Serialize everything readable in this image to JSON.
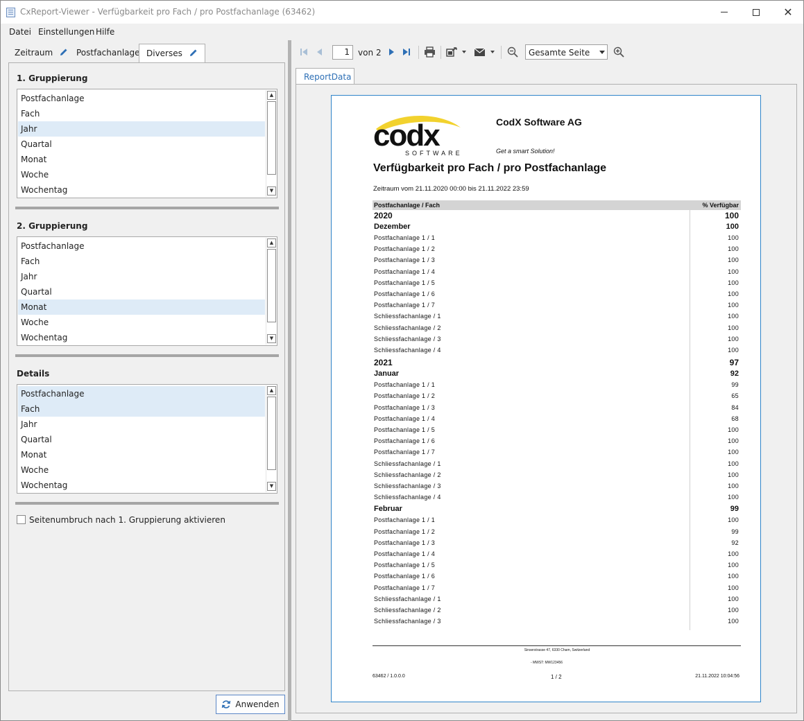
{
  "window": {
    "title": "CxReport-Viewer - Verfügbarkeit pro Fach / pro Postfachanlage (63462)",
    "close_glyph": "✕"
  },
  "menu": [
    "Datei",
    "Einstellungen",
    "Hilfe"
  ],
  "tabs": [
    {
      "label": "Zeitraum",
      "edit_icon": true
    },
    {
      "label": "Postfachanlage",
      "edit_icon": false
    },
    {
      "label": "Diverses",
      "edit_icon": true,
      "active": true
    }
  ],
  "groups": [
    {
      "title": "1. Gruppierung",
      "items": [
        "Postfachanlage",
        "Fach",
        "Jahr",
        "Quartal",
        "Monat",
        "Woche",
        "Wochentag"
      ],
      "selected": [
        2
      ]
    },
    {
      "title": "2. Gruppierung",
      "items": [
        "Postfachanlage",
        "Fach",
        "Jahr",
        "Quartal",
        "Monat",
        "Woche",
        "Wochentag"
      ],
      "selected": [
        4
      ]
    },
    {
      "title": "Details",
      "items": [
        "Postfachanlage",
        "Fach",
        "Jahr",
        "Quartal",
        "Monat",
        "Woche",
        "Wochentag"
      ],
      "selected": [
        0,
        1
      ]
    }
  ],
  "page_break_checkbox": {
    "label": "Seitenumbruch nach 1. Gruppierung aktivieren",
    "checked": false
  },
  "apply_button": {
    "label": "Anwenden"
  },
  "toolbar": {
    "page_current": "1",
    "page_of_label": "von",
    "page_total": "2",
    "zoom_value": "Gesamte Seite"
  },
  "report_tab": {
    "label": "ReportData"
  },
  "report": {
    "logo_text": "codx",
    "logo_sub": "SOFTWARE",
    "company": "CodX Software AG",
    "slogan": "Get a smart Solution!",
    "title": "Verfügbarkeit pro Fach / pro Postfachanlage",
    "period": "Zeitraum vom 21.11.2020 00:00 bis 21.11.2022 23:59",
    "col_label": "Postfachanlage / Fach",
    "col_value": "% Verfügbar",
    "rows": [
      {
        "type": "year",
        "label": "2020",
        "value": "100"
      },
      {
        "type": "month",
        "label": "Dezember",
        "value": "100"
      },
      {
        "type": "det",
        "label": "Postfachanlage 1 / 1",
        "value": "100"
      },
      {
        "type": "det",
        "label": "Postfachanlage 1 / 2",
        "value": "100"
      },
      {
        "type": "det",
        "label": "Postfachanlage 1 / 3",
        "value": "100"
      },
      {
        "type": "det",
        "label": "Postfachanlage 1 / 4",
        "value": "100"
      },
      {
        "type": "det",
        "label": "Postfachanlage 1 / 5",
        "value": "100"
      },
      {
        "type": "det",
        "label": "Postfachanlage 1 / 6",
        "value": "100"
      },
      {
        "type": "det",
        "label": "Postfachanlage 1 / 7",
        "value": "100"
      },
      {
        "type": "det",
        "label": "Schliessfachanlage / 1",
        "value": "100"
      },
      {
        "type": "det",
        "label": "Schliessfachanlage / 2",
        "value": "100"
      },
      {
        "type": "det",
        "label": "Schliessfachanlage / 3",
        "value": "100"
      },
      {
        "type": "det",
        "label": "Schliessfachanlage / 4",
        "value": "100"
      },
      {
        "type": "year",
        "label": "2021",
        "value": "97"
      },
      {
        "type": "month",
        "label": "Januar",
        "value": "92"
      },
      {
        "type": "det",
        "label": "Postfachanlage 1 / 1",
        "value": "99"
      },
      {
        "type": "det",
        "label": "Postfachanlage 1 / 2",
        "value": "65"
      },
      {
        "type": "det",
        "label": "Postfachanlage 1 / 3",
        "value": "84"
      },
      {
        "type": "det",
        "label": "Postfachanlage 1 / 4",
        "value": "68"
      },
      {
        "type": "det",
        "label": "Postfachanlage 1 / 5",
        "value": "100"
      },
      {
        "type": "det",
        "label": "Postfachanlage 1 / 6",
        "value": "100"
      },
      {
        "type": "det",
        "label": "Postfachanlage 1 / 7",
        "value": "100"
      },
      {
        "type": "det",
        "label": "Schliessfachanlage / 1",
        "value": "100"
      },
      {
        "type": "det",
        "label": "Schliessfachanlage / 2",
        "value": "100"
      },
      {
        "type": "det",
        "label": "Schliessfachanlage / 3",
        "value": "100"
      },
      {
        "type": "det",
        "label": "Schliessfachanlage / 4",
        "value": "100"
      },
      {
        "type": "month",
        "label": "Februar",
        "value": "99"
      },
      {
        "type": "det",
        "label": "Postfachanlage 1 / 1",
        "value": "100"
      },
      {
        "type": "det",
        "label": "Postfachanlage 1 / 2",
        "value": "99"
      },
      {
        "type": "det",
        "label": "Postfachanlage 1 / 3",
        "value": "92"
      },
      {
        "type": "det",
        "label": "Postfachanlage 1 / 4",
        "value": "100"
      },
      {
        "type": "det",
        "label": "Postfachanlage 1 / 5",
        "value": "100"
      },
      {
        "type": "det",
        "label": "Postfachanlage 1 / 6",
        "value": "100"
      },
      {
        "type": "det",
        "label": "Postfachanlage 1 / 7",
        "value": "100"
      },
      {
        "type": "det",
        "label": "Schliessfachanlage / 1",
        "value": "100"
      },
      {
        "type": "det",
        "label": "Schliessfachanlage / 2",
        "value": "100"
      },
      {
        "type": "det",
        "label": "Schliessfachanlage / 3",
        "value": "100"
      }
    ],
    "footer": {
      "address": "Sinserstrasse 47, 6330 Cham, Switzerland",
      "mwst": "- MWST: MW123456",
      "version": "63462 / 1.0.0.0",
      "page": "1 / 2",
      "printed": "21.11.2022 10:04:56"
    }
  },
  "colors": {
    "accent": "#2e84c9",
    "selection": "#deebf7",
    "logo_yellow": "#f2d22e"
  }
}
